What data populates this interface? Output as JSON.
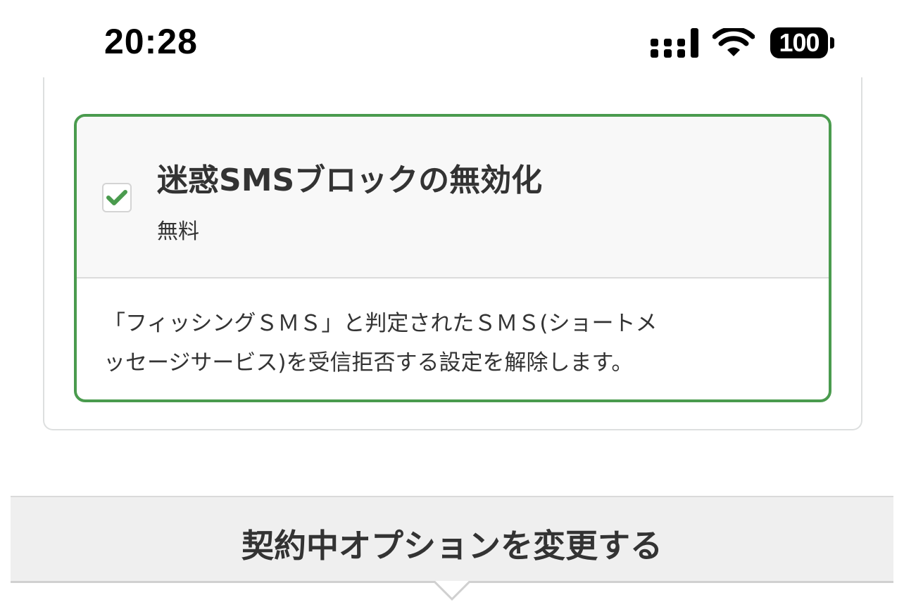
{
  "status_bar": {
    "time": "20:28",
    "battery": "100",
    "icons": [
      "signal-icon",
      "wifi-icon",
      "battery-icon"
    ]
  },
  "option": {
    "checked": true,
    "title": "迷惑SMSブロックの無効化",
    "price": "無料",
    "description_line1": "「フィッシングＳＭＳ」と判定されたＳＭＳ(ショートメ",
    "description_line2": "ッセージサービス)を受信拒否する設定を解除します。"
  },
  "section": {
    "label": "契約中オプションを変更する"
  },
  "colors": {
    "accent_green": "#4a9b4e",
    "text": "#333333"
  }
}
